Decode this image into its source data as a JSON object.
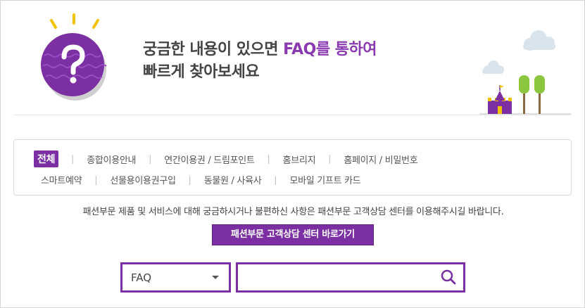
{
  "hero": {
    "title_line1_prefix": "궁금한 내용이 있으면 ",
    "title_line1_accent": "FAQ를 통하여",
    "title_line2": "빠르게 찾아보세요"
  },
  "categories": {
    "row1": [
      "전체",
      "종합이용안내",
      "연간이용권 / 드림포인트",
      "홈브리지",
      "홈페이지 / 비밀번호"
    ],
    "row2": [
      "스마트예약",
      "선물용이용권구입",
      "동물원 / 사육사",
      "모바일 기프트 카드"
    ],
    "active": "전체"
  },
  "notice": {
    "text": "패션부문 제품 및 서비스에 대해 궁금하시거나 불편하신 사항은 패션부문 고객상담 센터를 이용해주시길 바랍니다."
  },
  "center_button": {
    "label": "패션부문 고객상담 센터 바로가기"
  },
  "search": {
    "select_value": "FAQ",
    "input_value": "",
    "input_placeholder": ""
  },
  "colors": {
    "accent": "#7b2fa2",
    "text": "#444444"
  },
  "icons": {
    "hero": "question-mark-icon",
    "search": "search-icon",
    "caret": "caret-down-icon"
  }
}
